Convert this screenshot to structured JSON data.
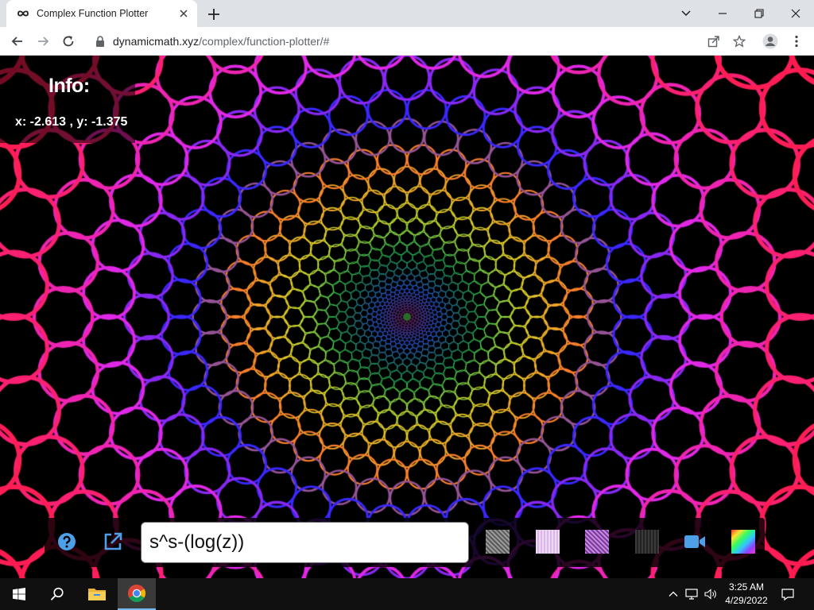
{
  "browser": {
    "tab_title": "Complex Function Plotter",
    "url_host": "dynamicmath.xyz",
    "url_path": "/complex/function-plotter/#"
  },
  "info": {
    "title": "Info:",
    "coords": "x: -2.613 , y: -1.375"
  },
  "controls": {
    "function_value": "s^s-(log(z))"
  },
  "colors": {
    "help_button": "#4d9fe8",
    "camera_button": "#4d9fe8",
    "swatch_gray": "#8a8a8a",
    "swatch_light": "#e8c8f0",
    "swatch_purple": "#b070d0",
    "swatch_dark": "#303030"
  },
  "taskbar": {
    "time": "3:25 AM",
    "date": "4/29/2022"
  }
}
